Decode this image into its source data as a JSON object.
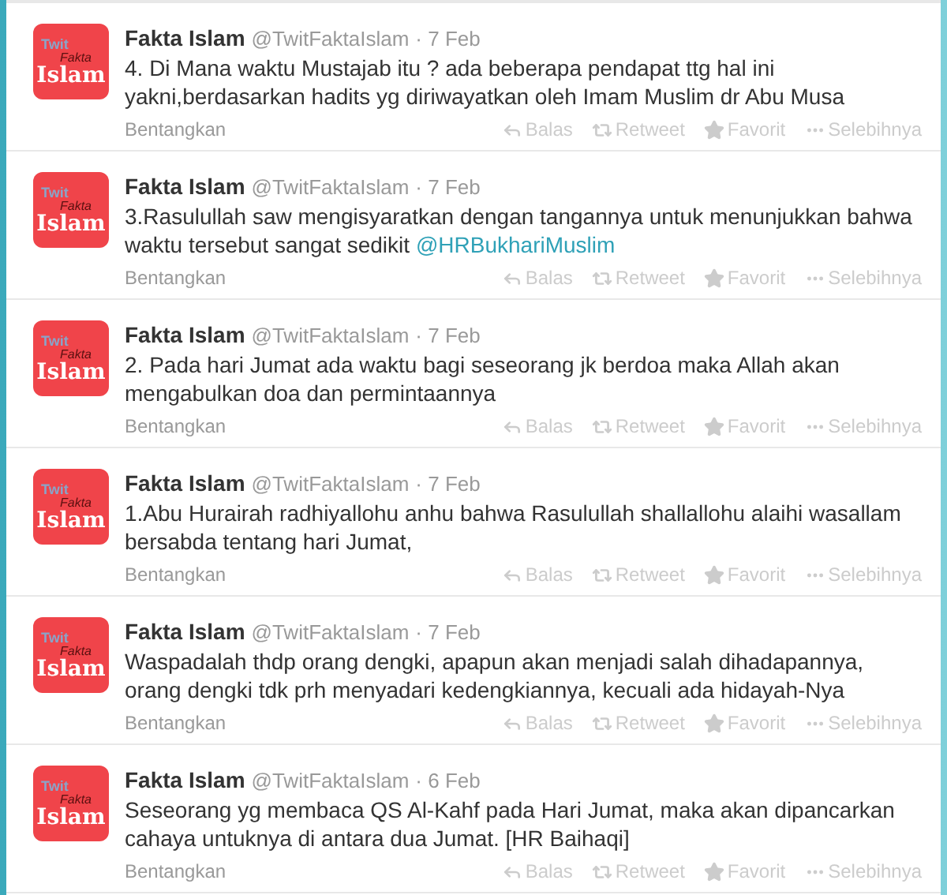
{
  "tweets": [
    {
      "avatar": {
        "line1": "Twit",
        "line2": "Fakta",
        "line3": "Islam"
      },
      "name": "Fakta Islam",
      "handle": "@TwitFaktaIslam",
      "date": "· 7 Feb",
      "text": "4. Di Mana waktu Mustajab itu ? ada beberapa pendapat ttg hal ini yakni,berdasarkan hadits yg diriwayatkan oleh Imam Muslim dr Abu Musa",
      "expand": "Bentangkan",
      "actions": [
        {
          "kind": "reply",
          "label": "Balas"
        },
        {
          "kind": "retweet",
          "label": "Retweet"
        },
        {
          "kind": "favorite",
          "label": "Favorit"
        },
        {
          "kind": "more",
          "label": "Selebihnya"
        }
      ]
    },
    {
      "avatar": {
        "line1": "Twit",
        "line2": "Fakta",
        "line3": "Islam"
      },
      "name": "Fakta Islam",
      "handle": "@TwitFaktaIslam",
      "date": "· 7 Feb",
      "text": "3.Rasulullah saw mengisyaratkan dengan tangannya untuk menunjukkan bahwa waktu tersebut sangat sedikit",
      "mention": "@HRBukhariMuslim",
      "expand": "Bentangkan",
      "actions": [
        {
          "kind": "reply",
          "label": "Balas"
        },
        {
          "kind": "retweet",
          "label": "Retweet"
        },
        {
          "kind": "favorite",
          "label": "Favorit"
        },
        {
          "kind": "more",
          "label": "Selebihnya"
        }
      ]
    },
    {
      "avatar": {
        "line1": "Twit",
        "line2": "Fakta",
        "line3": "Islam"
      },
      "name": "Fakta Islam",
      "handle": "@TwitFaktaIslam",
      "date": "· 7 Feb",
      "text": "2. Pada hari Jumat ada waktu bagi seseorang jk berdoa maka Allah akan mengabulkan doa dan permintaannya",
      "expand": "Bentangkan",
      "actions": [
        {
          "kind": "reply",
          "label": "Balas"
        },
        {
          "kind": "retweet",
          "label": "Retweet"
        },
        {
          "kind": "favorite",
          "label": "Favorit"
        },
        {
          "kind": "more",
          "label": "Selebihnya"
        }
      ]
    },
    {
      "avatar": {
        "line1": "Twit",
        "line2": "Fakta",
        "line3": "Islam"
      },
      "name": "Fakta Islam",
      "handle": "@TwitFaktaIslam",
      "date": "· 7 Feb",
      "text": "1.Abu Hurairah radhiyallohu anhu bahwa Rasulullah shallallohu alaihi wasallam bersabda tentang hari Jumat,",
      "expand": "Bentangkan",
      "actions": [
        {
          "kind": "reply",
          "label": "Balas"
        },
        {
          "kind": "retweet",
          "label": "Retweet"
        },
        {
          "kind": "favorite",
          "label": "Favorit"
        },
        {
          "kind": "more",
          "label": "Selebihnya"
        }
      ]
    },
    {
      "avatar": {
        "line1": "Twit",
        "line2": "Fakta",
        "line3": "Islam"
      },
      "name": "Fakta Islam",
      "handle": "@TwitFaktaIslam",
      "date": "· 7 Feb",
      "text": "Waspadalah thdp orang dengki, apapun akan menjadi salah dihadapannya, orang dengki tdk prh menyadari kedengkiannya, kecuali ada hidayah-Nya",
      "expand": "Bentangkan",
      "actions": [
        {
          "kind": "reply",
          "label": "Balas"
        },
        {
          "kind": "retweet",
          "label": "Retweet"
        },
        {
          "kind": "favorite",
          "label": "Favorit"
        },
        {
          "kind": "more",
          "label": "Selebihnya"
        }
      ]
    },
    {
      "avatar": {
        "line1": "Twit",
        "line2": "Fakta",
        "line3": "Islam"
      },
      "name": "Fakta Islam",
      "handle": "@TwitFaktaIslam",
      "date": "· 6 Feb",
      "text": "Seseorang yg membaca QS Al-Kahf pada Hari Jumat, maka akan dipancarkan cahaya untuknya di antara dua Jumat. [HR Baihaqi]",
      "expand": "Bentangkan",
      "actions": [
        {
          "kind": "reply",
          "label": "Balas"
        },
        {
          "kind": "retweet",
          "label": "Retweet"
        },
        {
          "kind": "favorite",
          "label": "Favorit"
        },
        {
          "kind": "more",
          "label": "Selebihnya"
        }
      ]
    }
  ]
}
